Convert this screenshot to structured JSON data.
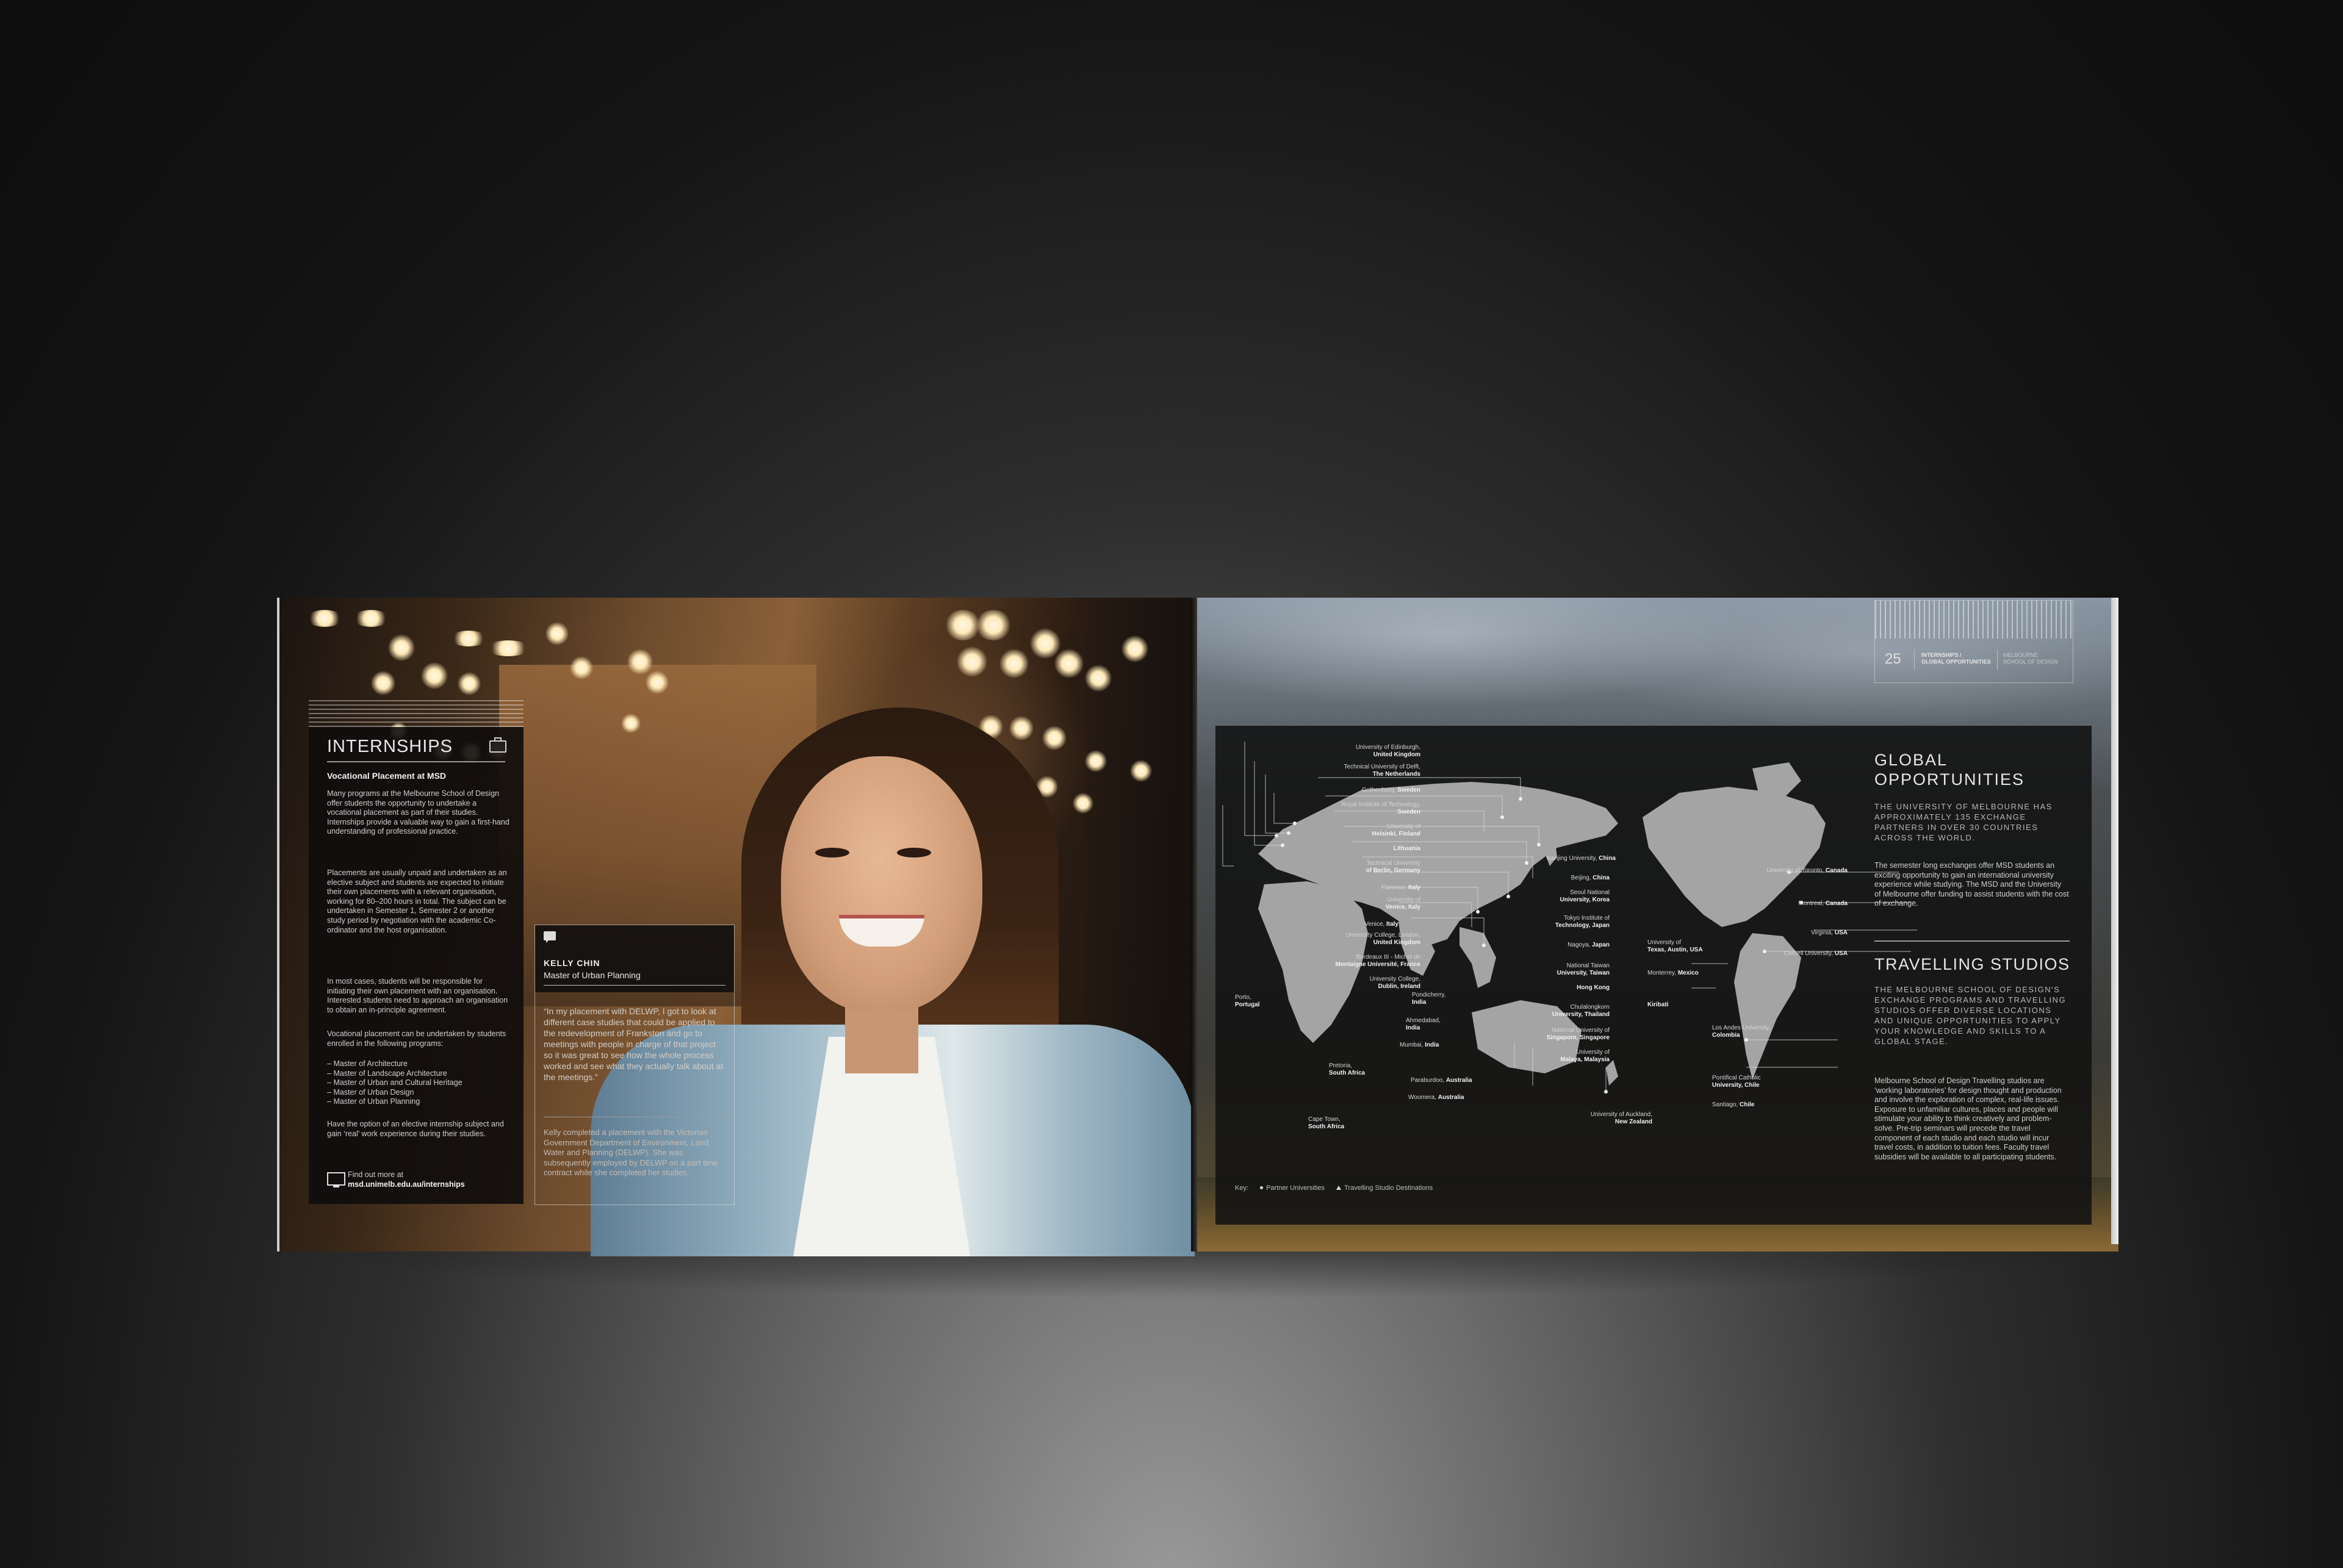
{
  "left_page": {
    "internships": {
      "title": "INTERNSHIPS",
      "subtitle": "Vocational Placement at MSD",
      "paragraphs": [
        "Many programs at the Melbourne School of Design offer students the opportunity to undertake a vocational placement as part of their studies. Internships provide a valuable way to gain a first-hand understanding of professional practice.",
        "Placements are usually unpaid and undertaken as an elective subject and students are expected to initiate their own placements with a relevant organisation, working for 80–200 hours in total. The subject can be undertaken in Semester 1, Semester 2 or another study period by negotiation with the academic Co-ordinator and the host organisation.",
        "In most cases, students will be responsible for initiating their own placement with an organisation. Interested students need to approach an organisation to obtain an in-principle agreement.",
        "Vocational placement can be undertaken by students enrolled in the following programs:"
      ],
      "programs": [
        "Master of Architecture",
        "Master of Landscape Architecture",
        "Master of Urban and Cultural Heritage",
        "Master of Urban Design",
        "Master of Urban Planning"
      ],
      "closing": "Have the option of an elective internship subject and gain ‘real’ work experience during their studies.",
      "link_label": "Find out more at",
      "link": "msd.unimelb.edu.au/internships"
    },
    "quote": {
      "name": "KELLY CHIN",
      "role": "Master of Urban Planning",
      "text": "“In my placement with DELWP, I got to look at different case studies that could be applied to the redevelopment of Frankston and go to meetings with people in charge of that project so it was great to see how the whole process worked and see what they actually talk about at the meetings.”",
      "footnote": "Kelly completed a placement with the Victorian Government Department of Environment, Land, Water and Planning (DELWP). She was subsequently employed by DELWP on a part time contract while she completed her studies."
    }
  },
  "right_page": {
    "header": {
      "page_number": "25",
      "section_line1": "INTERNSHIPS /",
      "section_line2": "GLOBAL OPPORTUNITIES",
      "school_line1": "MELBOURNE",
      "school_line2": "SCHOOL OF DESIGN"
    },
    "global": {
      "title_line1": "GLOBAL",
      "title_line2": "OPPORTUNITIES",
      "caps": "THE UNIVERSITY OF MELBOURNE HAS APPROXIMATELY 135 EXCHANGE PARTNERS IN OVER 30 COUNTRIES ACROSS THE WORLD.",
      "body": "The semester long exchanges offer MSD students an exciting opportunity to gain an international university experience while studying. The MSD and the University of Melbourne offer funding to assist students with the cost of exchange."
    },
    "travelling": {
      "title": "TRAVELLING STUDIOS",
      "caps": "THE MELBOURNE SCHOOL OF DESIGN'S EXCHANGE PROGRAMS AND TRAVELLING STUDIOS OFFER DIVERSE LOCATIONS AND UNIQUE OPPORTUNITIES TO APPLY YOUR KNOWLEDGE AND SKILLS TO A GLOBAL STAGE.",
      "body": "Melbourne School of Design Travelling studios are ‘working laboratories’ for design thought and production and involve the exploration of complex, real-life issues. Exposure to unfamiliar cultures, places and people will stimulate your ability to think creatively and problem-solve. Pre-trip seminars will precede the travel component of each studio and each studio will incur travel costs, in addition to tuition fees. Faculty travel subsidies will be available to all participating students."
    },
    "map": {
      "key_label": "Key:",
      "key_partner": "Partner Universities",
      "key_studio": "Travelling Studio Destinations",
      "labels": [
        {
          "l1": "University of Edinburgh,",
          "l2": "United Kingdom"
        },
        {
          "l1": "Technical University of Delft,",
          "l2": "The Netherlands"
        },
        {
          "l1": "Gothenburg,",
          "l2": "Sweden"
        },
        {
          "l1": "Royal Institute of Technology,",
          "l2": "Sweden"
        },
        {
          "l1": "University of",
          "l2": "Helsinki, Finland"
        },
        {
          "l1": "",
          "l2": "Lithuania"
        },
        {
          "l1": "Technical University",
          "l2": "of Berlin, Germany"
        },
        {
          "l1": "Florence,",
          "l2": "Italy"
        },
        {
          "l1": "University of",
          "l2": "Venice, Italy"
        },
        {
          "l1": "Venice,",
          "l2": "Italy"
        },
        {
          "l1": "University College, London,",
          "l2": "United Kingdom"
        },
        {
          "l1": "Bordeaux III - Michel de",
          "l2": "Montaigne Université, France"
        },
        {
          "l1": "University College,",
          "l2": "Dublin, Ireland"
        },
        {
          "l1": "Porto,",
          "l2": "Portugal"
        },
        {
          "l1": "Pretoria,",
          "l2": "South Africa"
        },
        {
          "l1": "Cape Town,",
          "l2": "South Africa"
        },
        {
          "l1": "Nanjing University,",
          "l2": "China"
        },
        {
          "l1": "Beijing,",
          "l2": "China"
        },
        {
          "l1": "Seoul National",
          "l2": "University, Korea"
        },
        {
          "l1": "Tokyo Institute of",
          "l2": "Technology, Japan"
        },
        {
          "l1": "Nagoya,",
          "l2": "Japan"
        },
        {
          "l1": "National Taiwan",
          "l2": "University, Taiwan"
        },
        {
          "l1": "",
          "l2": "Hong Kong"
        },
        {
          "l1": "Chulalongkorn",
          "l2": "University, Thailand"
        },
        {
          "l1": "National University of",
          "l2": "Singapore, Singapore"
        },
        {
          "l1": "University of",
          "l2": "Malaya, Malaysia"
        },
        {
          "l1": "Pondicherry,",
          "l2": "India"
        },
        {
          "l1": "Ahmedabad,",
          "l2": "India"
        },
        {
          "l1": "Mumbai,",
          "l2": "India"
        },
        {
          "l1": "Paraburdoo,",
          "l2": "Australia"
        },
        {
          "l1": "Woomera,",
          "l2": "Australia"
        },
        {
          "l1": "University of Auckland,",
          "l2": "New Zealand"
        },
        {
          "l1": "",
          "l2": "Kiribati"
        },
        {
          "l1": "University of Toronto,",
          "l2": "Canada"
        },
        {
          "l1": "Montreal,",
          "l2": "Canada"
        },
        {
          "l1": "Virginia,",
          "l2": "USA"
        },
        {
          "l1": "Cornell University,",
          "l2": "USA"
        },
        {
          "l1": "University of",
          "l2": "Texas, Austin, USA"
        },
        {
          "l1": "Monterrey,",
          "l2": "Mexico"
        },
        {
          "l1": "Los Andes University,",
          "l2": "Colombia"
        },
        {
          "l1": "Pontifical Catholic",
          "l2": "University, Chile"
        },
        {
          "l1": "Santiago,",
          "l2": "Chile"
        }
      ]
    }
  }
}
